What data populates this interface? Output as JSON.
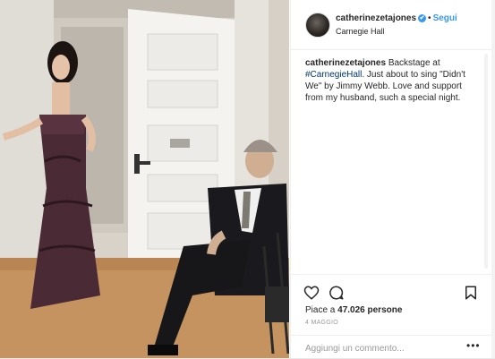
{
  "header": {
    "username": "catherinezetajones",
    "verified_badge": "✔",
    "separator": "•",
    "follow_label": "Segui",
    "location": "Carnegie Hall"
  },
  "caption": {
    "username": "catherinezetajones",
    "text_before": " Backstage at ",
    "hashtag": "#CarnegieHall",
    "text_after": ". Just about to sing \"Didn't We\" by Jimmy Webb. Love and support from my husband, such a special night."
  },
  "likes": {
    "prefix": "Piace a ",
    "count": "47.026",
    "suffix": " persone"
  },
  "date": "4 MAGGIO",
  "comment": {
    "placeholder": "Aggiungi un commento...",
    "more_label": "•••"
  },
  "icons": {
    "like": "heart-icon",
    "comment": "comment-icon",
    "save": "bookmark-icon",
    "more": "more-options-icon"
  },
  "colors": {
    "link_blue": "#3897f0",
    "hashtag_blue": "#003569",
    "text": "#262626",
    "muted": "#999999",
    "border": "#efefef"
  }
}
